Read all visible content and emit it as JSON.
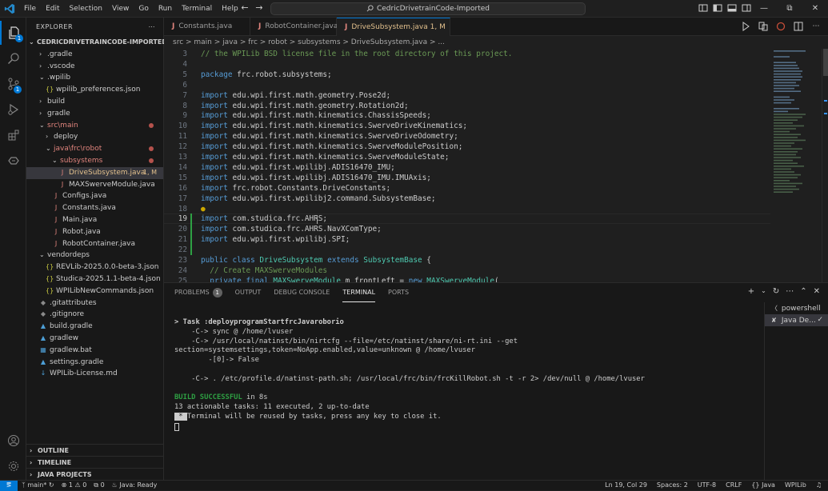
{
  "menu": [
    "File",
    "Edit",
    "Selection",
    "View",
    "Go",
    "Run",
    "Terminal",
    "Help"
  ],
  "command_center": "CedricDrivetrainCode-Imported",
  "explorer": {
    "title": "EXPLORER",
    "root": "CEDRICDRIVETRAINCODE-IMPORTED",
    "items": [
      {
        "label": ".gradle",
        "depth": 1,
        "type": "folder",
        "open": false
      },
      {
        "label": ".vscode",
        "depth": 1,
        "type": "folder",
        "open": false
      },
      {
        "label": ".wpilib",
        "depth": 1,
        "type": "folder",
        "open": true
      },
      {
        "label": "wpilib_preferences.json",
        "depth": 2,
        "type": "json"
      },
      {
        "label": "build",
        "depth": 1,
        "type": "folder",
        "open": false
      },
      {
        "label": "gradle",
        "depth": 1,
        "type": "folder",
        "open": false
      },
      {
        "label": "src\\main",
        "depth": 1,
        "type": "folder",
        "open": true,
        "modified": true
      },
      {
        "label": "deploy",
        "depth": 2,
        "type": "folder",
        "open": false
      },
      {
        "label": "java\\frc\\robot",
        "depth": 2,
        "type": "folder",
        "open": true,
        "modified": true
      },
      {
        "label": "subsystems",
        "depth": 3,
        "type": "folder",
        "open": true,
        "modified": true
      },
      {
        "label": "DriveSubsystem.java",
        "depth": 4,
        "type": "java",
        "mark": "1, M",
        "selected": true
      },
      {
        "label": "MAXSwerveModule.java",
        "depth": 4,
        "type": "java"
      },
      {
        "label": "Configs.java",
        "depth": 3,
        "type": "java"
      },
      {
        "label": "Constants.java",
        "depth": 3,
        "type": "java"
      },
      {
        "label": "Main.java",
        "depth": 3,
        "type": "java"
      },
      {
        "label": "Robot.java",
        "depth": 3,
        "type": "java"
      },
      {
        "label": "RobotContainer.java",
        "depth": 3,
        "type": "java"
      },
      {
        "label": "vendordeps",
        "depth": 1,
        "type": "folder",
        "open": true
      },
      {
        "label": "REVLib-2025.0.0-beta-3.json",
        "depth": 2,
        "type": "json"
      },
      {
        "label": "Studica-2025.1.1-beta-4.json",
        "depth": 2,
        "type": "json"
      },
      {
        "label": "WPILibNewCommands.json",
        "depth": 2,
        "type": "json"
      },
      {
        "label": ".gitattributes",
        "depth": 1,
        "type": "git"
      },
      {
        "label": ".gitignore",
        "depth": 1,
        "type": "git"
      },
      {
        "label": "build.gradle",
        "depth": 1,
        "type": "gradle"
      },
      {
        "label": "gradlew",
        "depth": 1,
        "type": "gradle"
      },
      {
        "label": "gradlew.bat",
        "depth": 1,
        "type": "bat"
      },
      {
        "label": "settings.gradle",
        "depth": 1,
        "type": "gradle"
      },
      {
        "label": "WPILib-License.md",
        "depth": 1,
        "type": "md"
      }
    ],
    "sections": [
      "OUTLINE",
      "TIMELINE",
      "JAVA PROJECTS"
    ]
  },
  "tabs": [
    {
      "label": "Constants.java"
    },
    {
      "label": "RobotContainer.java"
    },
    {
      "label": "DriveSubsystem.java",
      "mark": "1, M",
      "active": true
    }
  ],
  "breadcrumb": "src > main > java > frc > robot > subsystems > DriveSubsystem.java > ...",
  "code_lines": [
    {
      "n": "3",
      "t": "// the WPILib BSD license file in the root directory of this project.",
      "k": "cm"
    },
    {
      "n": "4",
      "t": "",
      "k": ""
    },
    {
      "n": "5",
      "t": "package frc.robot.subsystems;",
      "k": "pkg"
    },
    {
      "n": "6",
      "t": "",
      "k": ""
    },
    {
      "n": "7",
      "t": "import edu.wpi.first.math.geometry.Pose2d;",
      "k": "imp"
    },
    {
      "n": "8",
      "t": "import edu.wpi.first.math.geometry.Rotation2d;",
      "k": "imp"
    },
    {
      "n": "9",
      "t": "import edu.wpi.first.math.kinematics.ChassisSpeeds;",
      "k": "imp"
    },
    {
      "n": "10",
      "t": "import edu.wpi.first.math.kinematics.SwerveDriveKinematics;",
      "k": "imp"
    },
    {
      "n": "11",
      "t": "import edu.wpi.first.math.kinematics.SwerveDriveOdometry;",
      "k": "imp"
    },
    {
      "n": "12",
      "t": "import edu.wpi.first.math.kinematics.SwerveModulePosition;",
      "k": "imp"
    },
    {
      "n": "13",
      "t": "import edu.wpi.first.math.kinematics.SwerveModuleState;",
      "k": "imp"
    },
    {
      "n": "14",
      "t": "import edu.wpi.first.wpilibj.ADIS16470_IMU;",
      "k": "imp"
    },
    {
      "n": "15",
      "t": "import edu.wpi.first.wpilibj.ADIS16470_IMU.IMUAxis;",
      "k": "imp"
    },
    {
      "n": "16",
      "t": "import frc.robot.Constants.DriveConstants;",
      "k": "imp"
    },
    {
      "n": "17",
      "t": "import edu.wpi.first.wpilibj2.command.SubsystemBase;",
      "k": "imp"
    },
    {
      "n": "18",
      "t": "",
      "k": "bulb"
    },
    {
      "n": "19",
      "t": "import com.studica.frc.AHRS;",
      "k": "imp"
    },
    {
      "n": "20",
      "t": "import com.studica.frc.AHRS.NavXComType;",
      "k": "imp"
    },
    {
      "n": "21",
      "t": "import edu.wpi.first.wpilibj.SPI;",
      "k": "imp"
    },
    {
      "n": "22",
      "t": "",
      "k": ""
    },
    {
      "n": "23",
      "t": "public class DriveSubsystem extends SubsystemBase {",
      "k": "cls"
    },
    {
      "n": "24",
      "t": "  // Create MAXSwerveModules",
      "k": "cm"
    },
    {
      "n": "25",
      "t": "  private final MAXSwerveModule m_frontLeft = new MAXSwerveModule(",
      "k": "fld"
    }
  ],
  "panel": {
    "tabs": [
      "PROBLEMS",
      "OUTPUT",
      "DEBUG CONSOLE",
      "TERMINAL",
      "PORTS"
    ],
    "problems_count": "1",
    "active_tab": "TERMINAL",
    "terminal_lines": [
      {
        "t": "> Task :deployprogramStartfrcJavaroborio",
        "s": "bold"
      },
      {
        "t": "    -C-> sync @ /home/lvuser",
        "s": ""
      },
      {
        "t": "    -C-> /usr/local/natinst/bin/nirtcfg --file=/etc/natinst/share/ni-rt.ini --get section=systemsettings,token=NoApp.enabled,value=unknown @ /home/lvuser",
        "s": ""
      },
      {
        "t": "        -[0]-> False",
        "s": ""
      },
      {
        "t": "",
        "s": ""
      },
      {
        "t": "    -C-> . /etc/profile.d/natinst-path.sh; /usr/local/frc/bin/frcKillRobot.sh -t -r 2> /dev/null @ /home/lvuser",
        "s": ""
      },
      {
        "t": "",
        "s": ""
      },
      {
        "t": "BUILD SUCCESSFUL in 8s",
        "s": "build"
      },
      {
        "t": "13 actionable tasks: 11 executed, 2 up-to-date",
        "s": ""
      },
      {
        "t": " * Terminal will be reused by tasks, press any key to close it.",
        "s": "reuse"
      }
    ],
    "terminal_list": [
      "powershell",
      "Java De..."
    ]
  },
  "status": {
    "branch": "main*",
    "errors": "1",
    "warnings": "0",
    "ports": "0",
    "java": "Java: Ready",
    "position": "Ln 19, Col 29",
    "spaces": "Spaces: 2",
    "encoding": "UTF-8",
    "eol": "CRLF",
    "language": "Java",
    "wpilib": "WPILib"
  },
  "colors": {
    "accent": "#0078d4",
    "modified": "#e2c08d",
    "error": "#e0847d",
    "keyword": "#569cd6",
    "comment": "#6a9955",
    "type": "#4ec9b0"
  }
}
